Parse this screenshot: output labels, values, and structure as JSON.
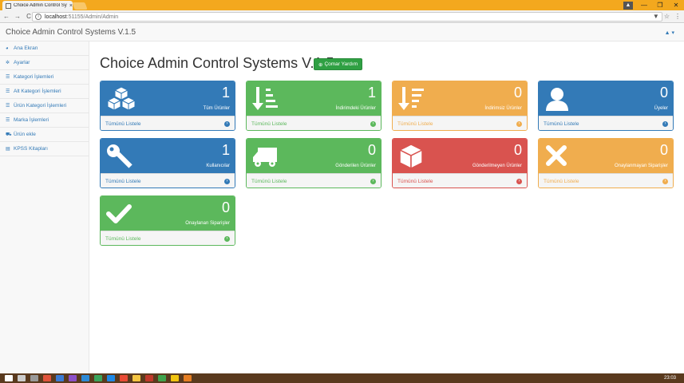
{
  "browser": {
    "tab_title": "Choice Admin Control Sy",
    "tab_close": "×",
    "url_host": "localhost",
    "url_rest": ":51155/Admin/Admin",
    "back": "←",
    "forward": "→",
    "reload": "C",
    "win_min": "—",
    "win_max": "❐",
    "win_close": "✕",
    "user": "▲",
    "star": "☆",
    "menu": "⋮",
    "bookmark": "▼"
  },
  "navbar": {
    "brand": "Choice Admin Control Systems V.1.5",
    "user_menu": "▲ ▾"
  },
  "sidebar": {
    "items": [
      {
        "label": "Ana Ekran",
        "icon": "dashboard-icon",
        "glyph": "◕"
      },
      {
        "label": "Ayarlar",
        "icon": "gear-icon",
        "glyph": "✲"
      },
      {
        "label": "Kategori İşlemleri",
        "icon": "list-icon",
        "glyph": "☰"
      },
      {
        "label": "Alt Kategori İşlemleri",
        "icon": "list-icon",
        "glyph": "☰"
      },
      {
        "label": "Ürün Kategori İşlemleri",
        "icon": "list-icon",
        "glyph": "☰"
      },
      {
        "label": "Marka İşlemleri",
        "icon": "list-icon",
        "glyph": "☰"
      },
      {
        "label": "Ürün ekle",
        "icon": "cart-icon",
        "glyph": "⛟"
      },
      {
        "label": "KPSS Kitapları",
        "icon": "book-icon",
        "glyph": "▤"
      }
    ]
  },
  "main": {
    "title": "Choice Admin Control Systems V.1.5",
    "help_button": "Çomar Yardım",
    "panels": [
      {
        "value": "1",
        "label": "Tüm Ürünler",
        "link": "Tümünü Listele",
        "color": "blue",
        "icon": "cubes-icon"
      },
      {
        "value": "1",
        "label": "İndirimdeki Ürünler",
        "link": "Tümünü Listele",
        "color": "green",
        "icon": "sort-down-icon"
      },
      {
        "value": "0",
        "label": "İndirimsiz Ürünler",
        "link": "Tümünü Listele",
        "color": "yellow",
        "icon": "sort-down-icon"
      },
      {
        "value": "0",
        "label": "Üyeler",
        "link": "Tümünü Listele",
        "color": "blue",
        "icon": "user-icon"
      },
      {
        "value": "1",
        "label": "Kullanıcılar",
        "link": "Tümünü Listele",
        "color": "blue",
        "icon": "key-icon"
      },
      {
        "value": "0",
        "label": "Gönderilen Ürünler",
        "link": "Tümünü Listele",
        "color": "green",
        "icon": "truck-icon"
      },
      {
        "value": "0",
        "label": "Gönderilmeyen Ürünler",
        "link": "Tümünü Listele",
        "color": "red",
        "icon": "cube-icon"
      },
      {
        "value": "0",
        "label": "Onaylanmayan Siparişler",
        "link": "Tümünü Listele",
        "color": "yellow",
        "icon": "times-icon"
      },
      {
        "value": "0",
        "label": "Onaylanan Siparişler",
        "link": "Tümünü Listele",
        "color": "green",
        "icon": "check-icon"
      }
    ]
  },
  "taskbar": {
    "clock": "23:03"
  },
  "colors": {
    "blue": "#337ab7",
    "green": "#5cb85c",
    "yellow": "#f0ad4e",
    "red": "#d9534f",
    "chrome": "#f3a81e"
  }
}
